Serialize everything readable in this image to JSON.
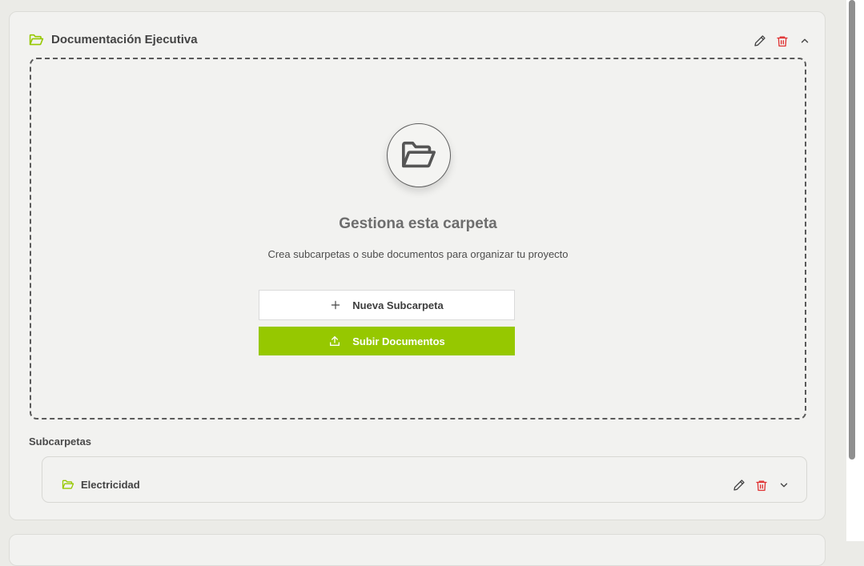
{
  "folder": {
    "title": "Documentación Ejecutiva",
    "icon": "folder-open-icon",
    "accent_color": "#96c800"
  },
  "dropzone": {
    "title": "Gestiona esta carpeta",
    "description": "Crea subcarpetas o sube documentos para organizar tu proyecto",
    "new_subfolder_label": "Nueva Subcarpeta",
    "upload_label": "Subir Documentos",
    "upload_color": "#96c800"
  },
  "subfolders": {
    "heading": "Subcarpetas",
    "items": [
      {
        "name": "Electricidad"
      }
    ]
  },
  "colors": {
    "delete": "#e03131",
    "background": "#ebebe7"
  }
}
